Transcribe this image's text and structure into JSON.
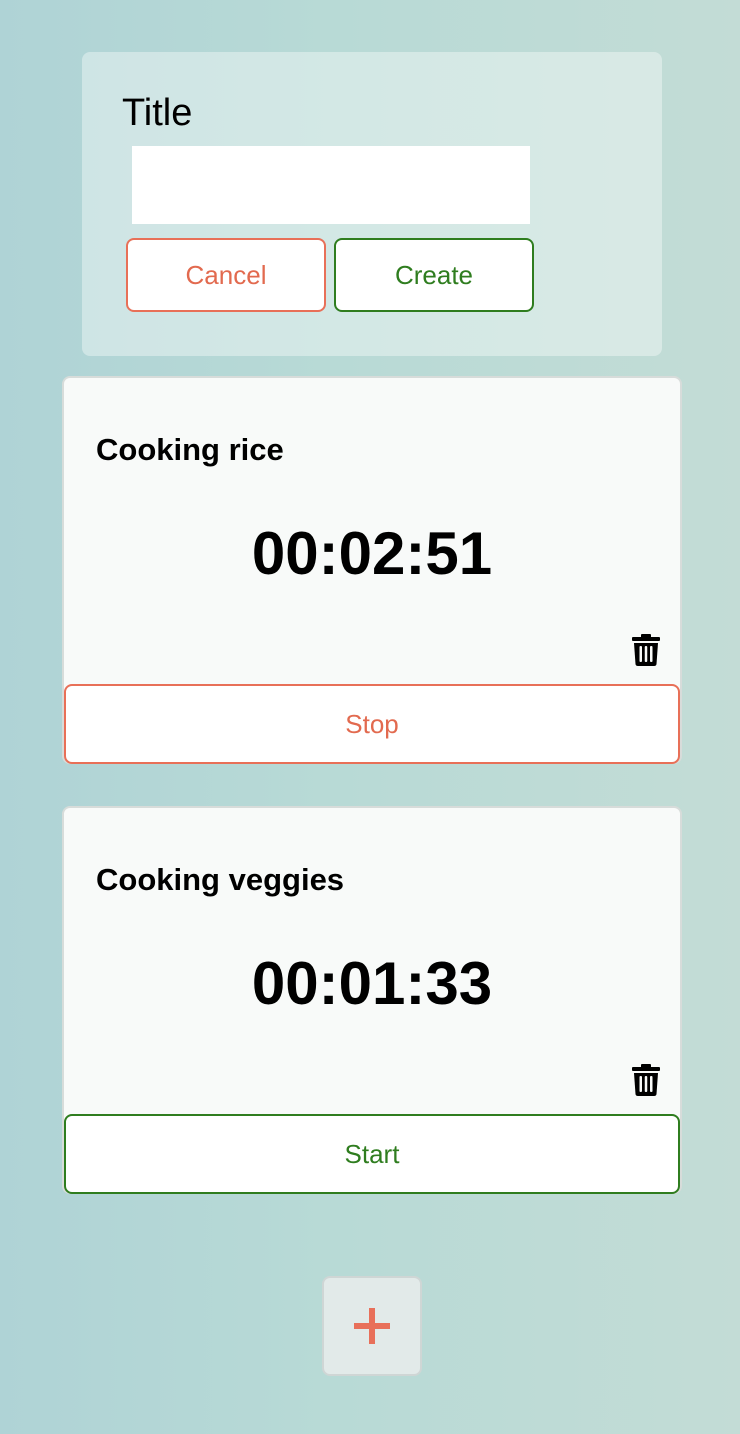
{
  "form": {
    "title_label": "Title",
    "title_input_value": "",
    "title_input_placeholder": "",
    "cancel_label": "Cancel",
    "create_label": "Create"
  },
  "timers": [
    {
      "title": "Cooking rice",
      "elapsed": "00:02:51",
      "action_label": "Stop",
      "running": true
    },
    {
      "title": "Cooking veggies",
      "elapsed": "00:01:33",
      "action_label": "Start",
      "running": false
    }
  ],
  "add_button": {
    "icon": "plus-icon"
  },
  "colors": {
    "cancel_red": "#e26a4f",
    "create_green": "#2f7d1f",
    "add_plus": "#e8705a"
  },
  "icons": {
    "delete": "trash-icon"
  }
}
